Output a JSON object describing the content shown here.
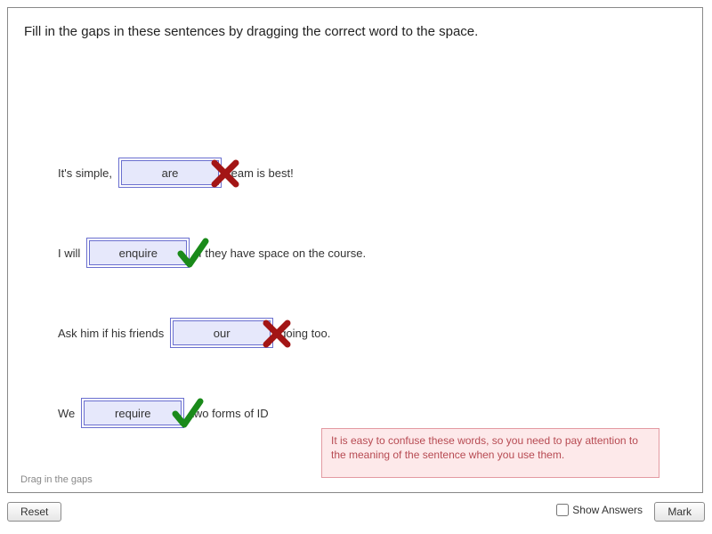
{
  "instructions": "Fill in the gaps in these sentences by dragging the correct word to the space.",
  "rows": [
    {
      "before": "It's simple,",
      "slot": "are",
      "after": "team is best!",
      "correct": false
    },
    {
      "before": "I will",
      "slot": "enquire",
      "after": "if they have space on the course.",
      "correct": true
    },
    {
      "before": "Ask him if his friends",
      "slot": "our",
      "after": "going too.",
      "correct": false
    },
    {
      "before": "We",
      "slot": "require",
      "after": "two forms of ID",
      "correct": true
    }
  ],
  "feedback": "It is easy to confuse these words, so you need to pay attention to the meaning of the sentence when you use them.",
  "hint": "Drag in the gaps",
  "toolbar": {
    "reset": "Reset",
    "show_answers": "Show Answers",
    "mark": "Mark"
  },
  "colors": {
    "cross": "#a31515",
    "tick": "#1a8a1a"
  }
}
